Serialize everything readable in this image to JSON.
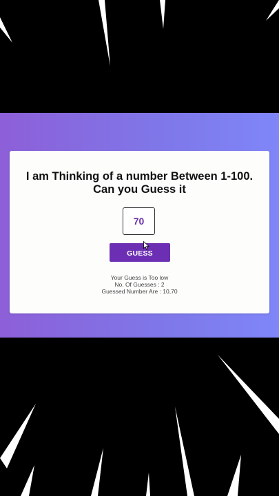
{
  "game": {
    "headline_line1": "I am Thinking of a number Between 1-100.",
    "headline_line2": "Can you Guess it",
    "input_value": "70",
    "guess_button_label": "GUESS",
    "feedback": "Your Guess is Too low",
    "guess_count": "No. Of Guesses : 2",
    "guessed_numbers": "Guessed Number Are : 10,70"
  },
  "colors": {
    "accent_purple": "#6c2fb3",
    "band_left": "#8d5fd8",
    "band_right": "#7f86f8",
    "card_background": "#fdfdfc",
    "page_background": "#000000"
  },
  "icons": [
    "cursor-icon"
  ]
}
